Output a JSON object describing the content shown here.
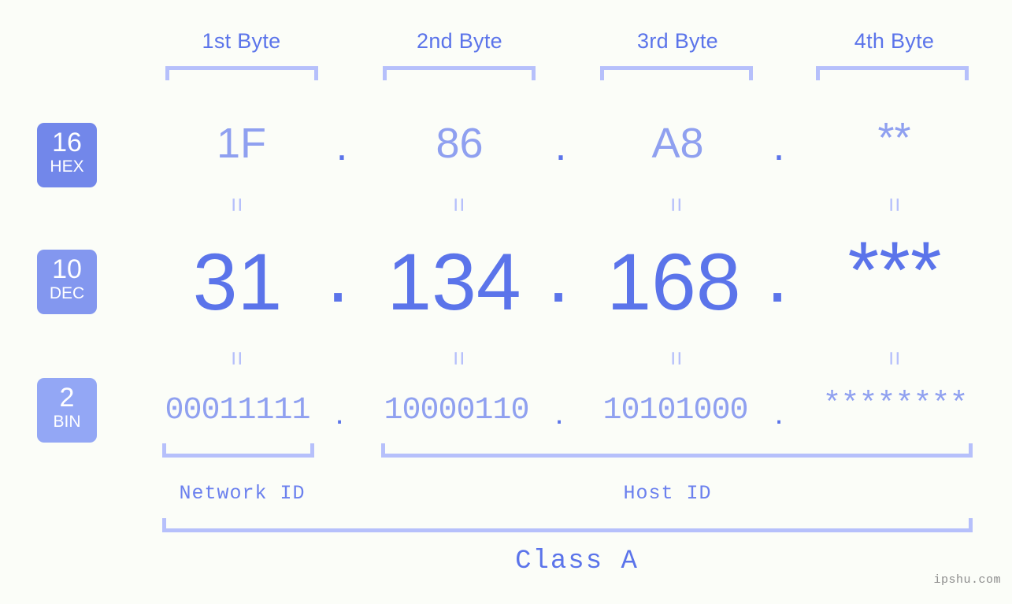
{
  "meta": {
    "background_color": "#fbfdf8",
    "accent_color": "#5b74ea",
    "light_accent_color": "#8fa0f0",
    "bracket_color": "#b6c0fb"
  },
  "headers": [
    {
      "label": "1st Byte"
    },
    {
      "label": "2nd Byte"
    },
    {
      "label": "3rd Byte"
    },
    {
      "label": "4th Byte"
    }
  ],
  "bases": [
    {
      "number": "16",
      "name": "HEX",
      "color": "#7287ea"
    },
    {
      "number": "10",
      "name": "DEC",
      "color": "#8397ef"
    },
    {
      "number": "2",
      "name": "BIN",
      "color": "#93a7f5"
    }
  ],
  "rows": {
    "hex": {
      "bytes": [
        "1F",
        "86",
        "A8",
        "**"
      ],
      "separator": "."
    },
    "dec": {
      "bytes": [
        "31",
        "134",
        "168",
        "***"
      ],
      "separator": "."
    },
    "bin": {
      "bytes": [
        "00011111",
        "10000110",
        "10101000",
        "********"
      ],
      "separator": "."
    }
  },
  "connectors": {
    "symbol": "="
  },
  "sections": [
    {
      "label": "Network ID"
    },
    {
      "label": "Host ID"
    }
  ],
  "class": {
    "label": "Class A"
  },
  "watermark": {
    "text": "ipshu.com"
  }
}
